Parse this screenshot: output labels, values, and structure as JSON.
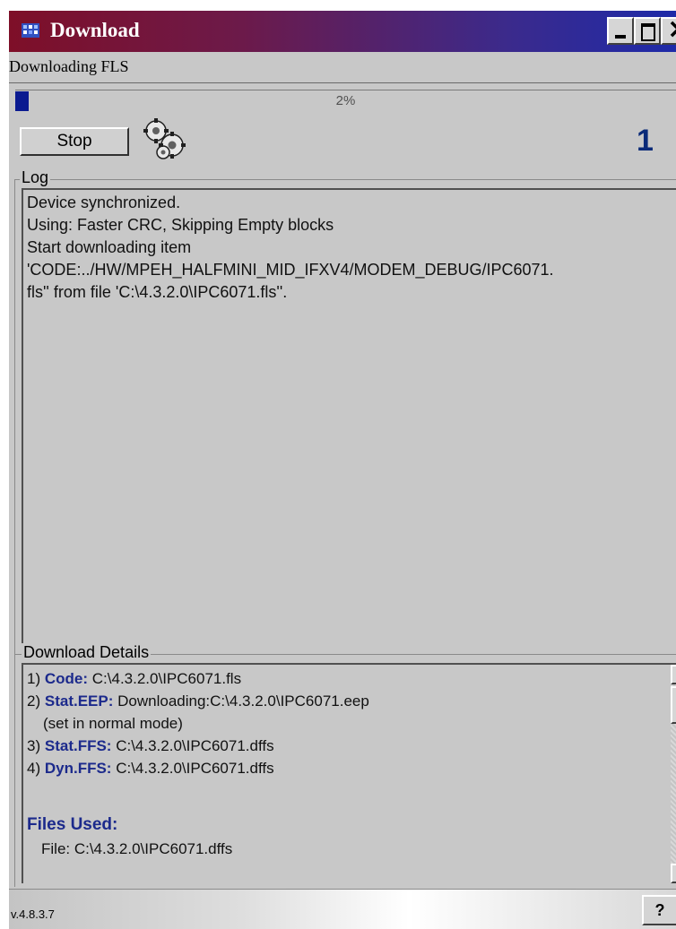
{
  "window": {
    "title": "Download",
    "minimize_label": "",
    "maximize_label": "",
    "close_label": ""
  },
  "status": {
    "label": "Downloading FLS",
    "progress_percent": 2,
    "progress_text": "2%",
    "counter": "1"
  },
  "toolbar": {
    "stop_label": "Stop",
    "gears_icon": "gears-icon"
  },
  "log": {
    "group_title": "Log",
    "lines": [
      "Device synchronized.",
      "Using: Faster CRC, Skipping Empty blocks",
      "Start downloading item",
      "'CODE:../HW/MPEH_HALFMINI_MID_IFXV4/MODEM_DEBUG/IPC6071.",
      "fls'' from file 'C:\\4.3.2.0\\IPC6071.fls''."
    ]
  },
  "details": {
    "group_title": "Download Details",
    "items": [
      {
        "num": "1)",
        "key": "Code:",
        "value": "C:\\4.3.2.0\\IPC6071.fls"
      },
      {
        "num": "2)",
        "key": "Stat.EEP:",
        "value": "Downloading:C:\\4.3.2.0\\IPC6071.eep"
      },
      {
        "num": "",
        "key": "",
        "value": "(set in normal mode)"
      },
      {
        "num": "3)",
        "key": "Stat.FFS:",
        "value": "C:\\4.3.2.0\\IPC6071.dffs"
      },
      {
        "num": "4)",
        "key": "Dyn.FFS:",
        "value": "C:\\4.3.2.0\\IPC6071.dffs"
      }
    ],
    "files_used_label": "Files Used:",
    "file_line": "File: C:\\4.3.2.0\\IPC6071.dffs"
  },
  "footer": {
    "version": "v.4.8.3.7",
    "help_label": "?"
  },
  "colors": {
    "title_gradient_start": "#7e0f28",
    "title_gradient_end": "#1e2aa8",
    "progress_fill": "#0a1a90",
    "accent_text": "#1c2a8c"
  }
}
